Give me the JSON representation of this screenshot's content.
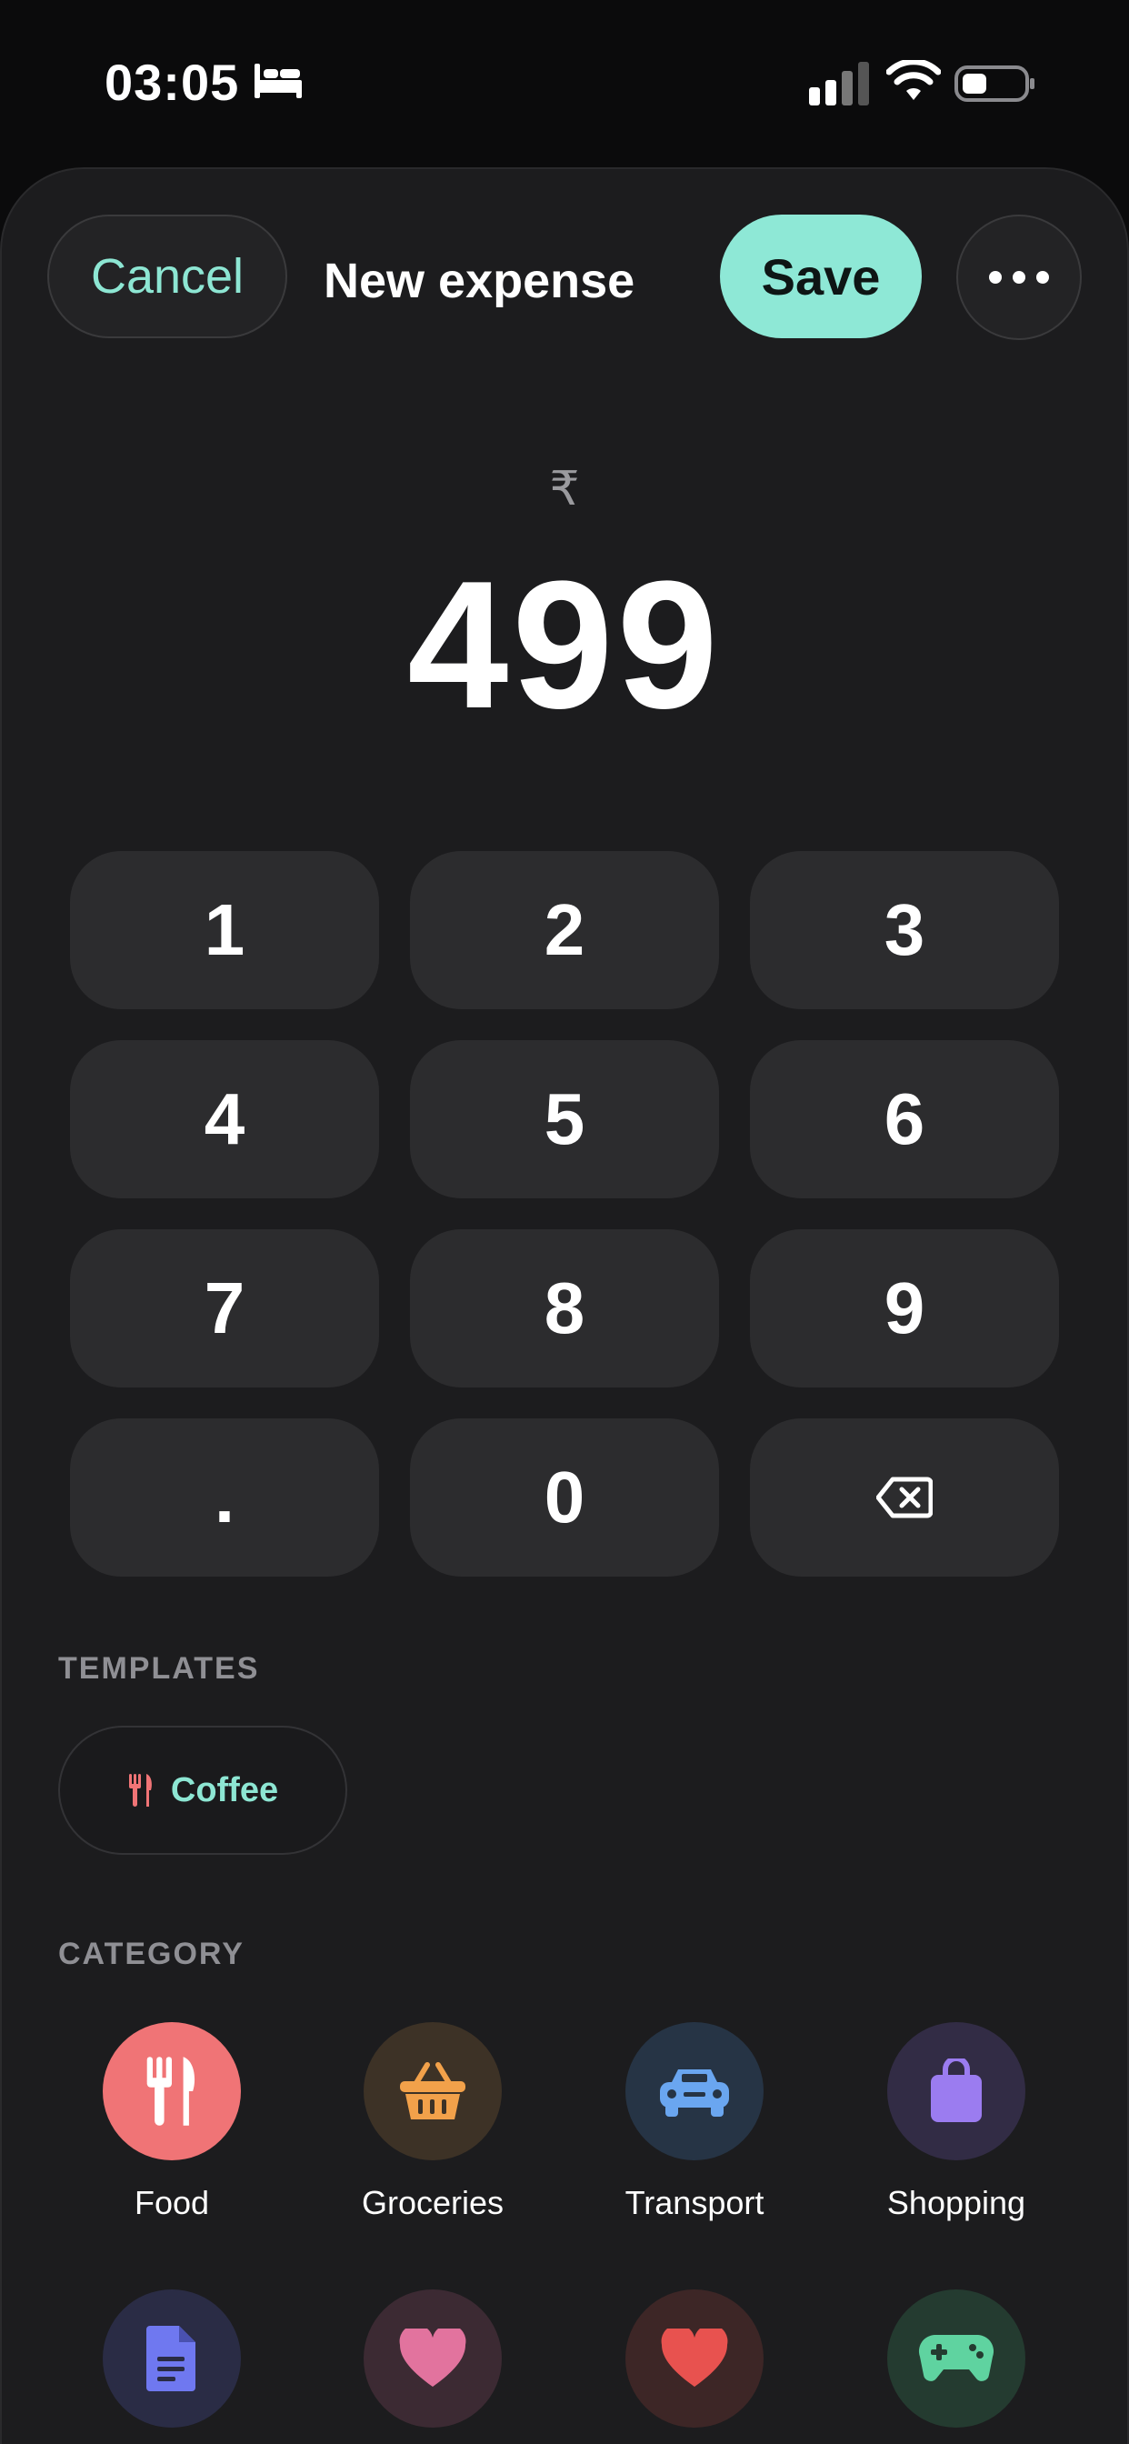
{
  "status_bar": {
    "time": "03:05"
  },
  "header": {
    "cancel_label": "Cancel",
    "title": "New expense",
    "save_label": "Save"
  },
  "amount": {
    "currency_symbol": "₹",
    "value": "499"
  },
  "keypad": {
    "keys": [
      "1",
      "2",
      "3",
      "4",
      "5",
      "6",
      "7",
      "8",
      "9",
      ".",
      "0"
    ]
  },
  "templates": {
    "section_label": "TEMPLATES",
    "items": [
      {
        "label": "Coffee",
        "icon": "fork-knife-icon"
      }
    ]
  },
  "category": {
    "section_label": "CATEGORY",
    "items": [
      {
        "label": "Food",
        "icon": "fork-knife-icon",
        "color": "#f07476",
        "selected": true
      },
      {
        "label": "Groceries",
        "icon": "basket-icon",
        "color": "#f2a14a"
      },
      {
        "label": "Transport",
        "icon": "car-icon",
        "color": "#6aa6f0"
      },
      {
        "label": "Shopping",
        "icon": "shopping-bag-icon",
        "color": "#9b7cf0"
      },
      {
        "icon": "document-icon",
        "color": "#6f78f0"
      },
      {
        "icon": "heart-icon",
        "color": "#e2739e"
      },
      {
        "icon": "heart-icon",
        "color": "#e8524f"
      },
      {
        "icon": "gamepad-icon",
        "color": "#5fd3a0"
      }
    ]
  },
  "colors": {
    "accent": "#8ee8d6",
    "background": "#1c1c1e",
    "key": "#2c2c2e"
  }
}
